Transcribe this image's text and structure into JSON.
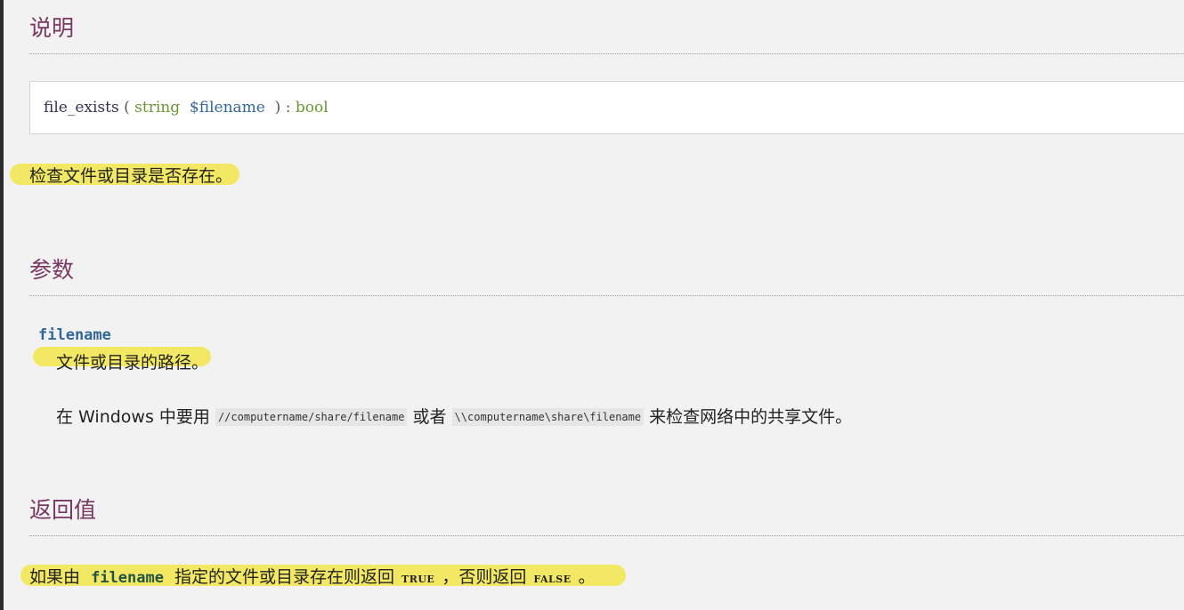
{
  "sections": {
    "description": {
      "heading": "说明",
      "synopsis": {
        "function_name": "file_exists",
        "open_paren": "(",
        "param_type": "string",
        "param_name": "$filename",
        "close_paren": ")",
        "colon": ":",
        "return_type": "bool"
      },
      "summary": "检查文件或目录是否存在。"
    },
    "parameters": {
      "heading": "参数",
      "term": "filename",
      "definition": "文件或目录的路径。",
      "note_prefix": "在 Windows 中要用",
      "note_code1": "//computername/share/filename",
      "note_mid": "或者",
      "note_code2": "\\\\computername\\share\\filename",
      "note_suffix": "来检查网络中的共享文件。"
    },
    "return_values": {
      "heading": "返回值",
      "text_prefix": "如果由",
      "param_ref": "filename",
      "text_mid": "指定的文件或目录存在则返回",
      "true_const": "TRUE",
      "text_sep": "，否则返回",
      "false_const": "FALSE",
      "text_end": "。"
    }
  },
  "colors": {
    "heading": "#793862",
    "highlight": "#f2e864",
    "type": "#669933",
    "param": "#336699"
  }
}
